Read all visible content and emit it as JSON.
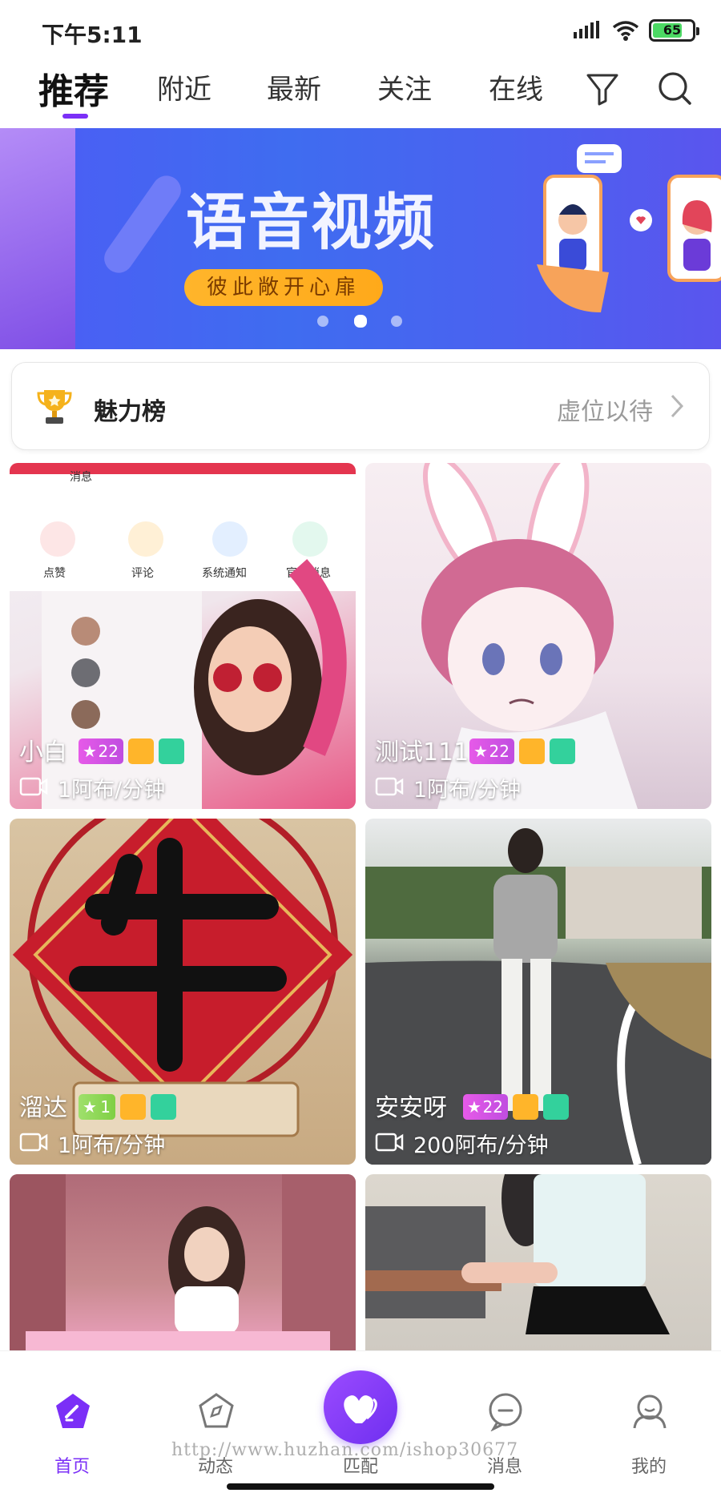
{
  "status_bar": {
    "time": "下午5:11",
    "battery": "65"
  },
  "tabs": [
    {
      "label": "推荐",
      "active": true
    },
    {
      "label": "附近",
      "active": false
    },
    {
      "label": "最新",
      "active": false
    },
    {
      "label": "关注",
      "active": false
    },
    {
      "label": "在线",
      "active": false
    }
  ],
  "header_icons": {
    "filter": "filter-icon",
    "search": "search-icon"
  },
  "banner": {
    "title": "语音视频",
    "subtitle": "彼此敞开心扉",
    "page_count": 3,
    "active_page": 2
  },
  "charm": {
    "label": "魅力榜",
    "right_text": "虚位以待"
  },
  "cards": [
    {
      "name": "小白",
      "level": "22",
      "price": "1阿布/分钟"
    },
    {
      "name": "测试111",
      "level": "22",
      "price": "1阿布/分钟"
    },
    {
      "name": "溜达",
      "level": "1",
      "price": "1阿布/分钟"
    },
    {
      "name": "安安呀",
      "level": "22",
      "price": "200阿布/分钟"
    }
  ],
  "bottom_nav": [
    {
      "label": "首页",
      "active": true,
      "icon": "home-icon"
    },
    {
      "label": "动态",
      "active": false,
      "icon": "compass-icon"
    },
    {
      "label": "匹配",
      "active": false,
      "icon": "heart-icon"
    },
    {
      "label": "消息",
      "active": false,
      "icon": "chat-icon"
    },
    {
      "label": "我的",
      "active": false,
      "icon": "profile-icon"
    }
  ],
  "watermark": "http://www.huzhan.com/ishop30677",
  "colors": {
    "accent": "#7b2ff7",
    "star_badge": "#d453e4",
    "cam_badge": "#ffb52a",
    "mic_badge": "#33d19c"
  }
}
